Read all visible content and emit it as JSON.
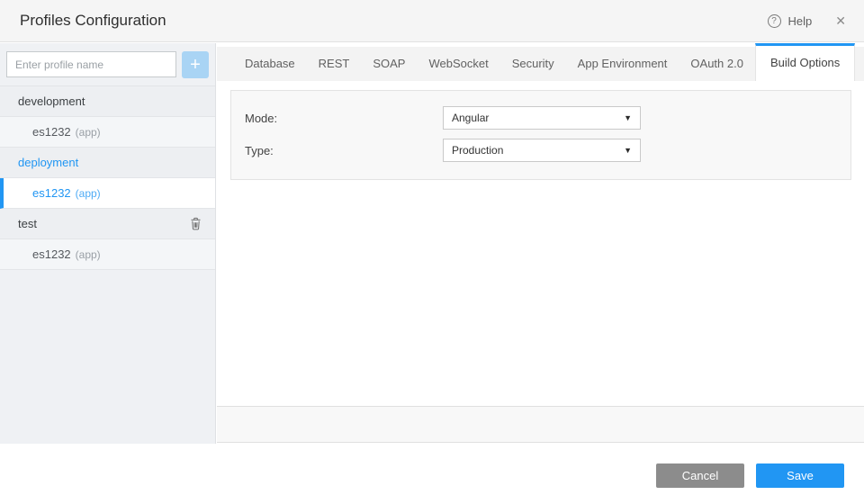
{
  "header": {
    "title": "Profiles Configuration",
    "help_label": "Help",
    "icons": {
      "help": "?",
      "close": "✕"
    }
  },
  "sidebar": {
    "input": {
      "placeholder": "Enter profile name",
      "value": ""
    },
    "add_button_glyph": "+",
    "profiles": [
      {
        "label": "development",
        "suffix": ""
      },
      {
        "label": "es1232",
        "suffix": "(app)"
      },
      {
        "label": "deployment",
        "suffix": ""
      },
      {
        "label": "es1232",
        "suffix": "(app)"
      },
      {
        "label": "test",
        "suffix": ""
      },
      {
        "label": "es1232",
        "suffix": "(app)"
      }
    ],
    "selected_profile": "deployment",
    "selected_app": "es1232 (app)"
  },
  "tabs": [
    {
      "label": "Database"
    },
    {
      "label": "REST"
    },
    {
      "label": "SOAP"
    },
    {
      "label": "WebSocket"
    },
    {
      "label": "Security"
    },
    {
      "label": "App Environment"
    },
    {
      "label": "OAuth 2.0"
    },
    {
      "label": "Build Options"
    }
  ],
  "active_tab": "Build Options",
  "build_options_form": {
    "fields": [
      {
        "label": "Mode:",
        "value": "Angular"
      },
      {
        "label": "Type:",
        "value": "Production"
      }
    ],
    "dropdown_arrow_glyph": "▼"
  },
  "footer": {
    "cancel_label": "Cancel",
    "save_label": "Save"
  },
  "colors": {
    "accent": "#2196f3",
    "save_button": "#2196f3",
    "cancel_button": "#8c8c8c",
    "header_bg": "#f5f5f5",
    "sidebar_bg": "#eff1f4",
    "tabbar_bg": "#f3f3f3",
    "panel_bg": "#f8f8f8",
    "add_button_bg": "#a9d4f4"
  }
}
